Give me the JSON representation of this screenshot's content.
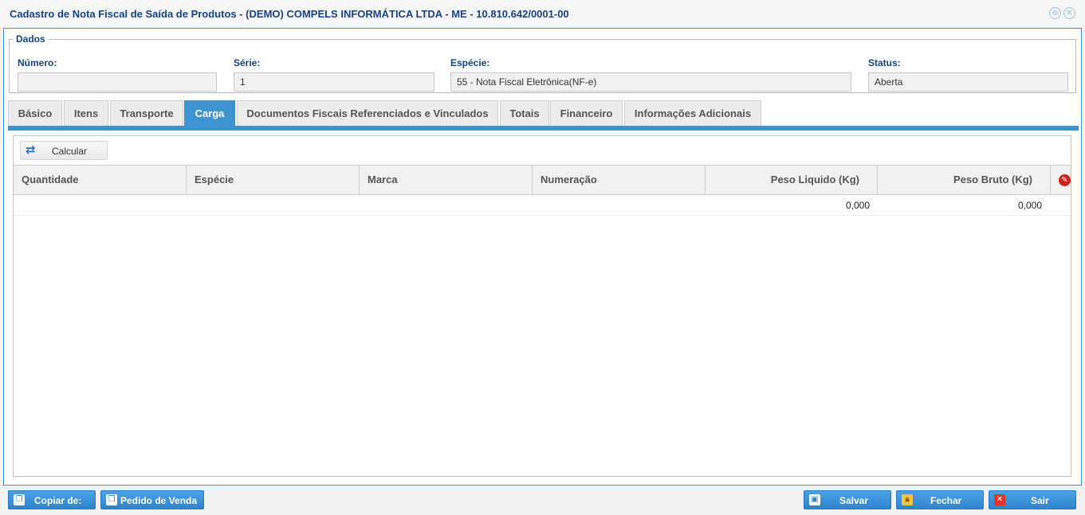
{
  "window": {
    "title": "Cadastro de Nota Fiscal de Saída de Produtos - (DEMO) COMPELS INFORMÁTICA LTDA - ME - 10.810.642/0001-00"
  },
  "dados": {
    "legend": "Dados",
    "numero": {
      "label": "Número:",
      "value": ""
    },
    "serie": {
      "label": "Série:",
      "value": "1"
    },
    "especie": {
      "label": "Espécie:",
      "value": "55 - Nota Fiscal Eletrônica(NF-e)"
    },
    "status": {
      "label": "Status:",
      "value": "Aberta"
    }
  },
  "tabs": [
    {
      "label": "Básico",
      "active": false
    },
    {
      "label": "Itens",
      "active": false
    },
    {
      "label": "Transporte",
      "active": false
    },
    {
      "label": "Carga",
      "active": true
    },
    {
      "label": "Documentos Fiscais Referenciados e Vinculados",
      "active": false
    },
    {
      "label": "Totais",
      "active": false
    },
    {
      "label": "Financeiro",
      "active": false
    },
    {
      "label": "Informações Adicionais",
      "active": false
    }
  ],
  "carga": {
    "calcular_label": "Calcular",
    "columns": [
      "Quantidade",
      "Espécie",
      "Marca",
      "Numeração",
      "Peso Liquido (Kg)",
      "Peso Bruto (Kg)"
    ],
    "rows": [
      {
        "quantidade": "",
        "especie": "",
        "marca": "",
        "numeracao": "",
        "peso_liquido": "0,000",
        "peso_bruto": "0,000"
      }
    ]
  },
  "footer": {
    "copiar_label": "Copiar de:",
    "pedido_label": "Pedido de Venda",
    "salvar_label": "Salvar",
    "fechar_label": "Fechar",
    "sair_label": "Sair"
  },
  "colors": {
    "accent": "#3d94d0",
    "title": "#15428b",
    "delete": "#d0211c"
  }
}
